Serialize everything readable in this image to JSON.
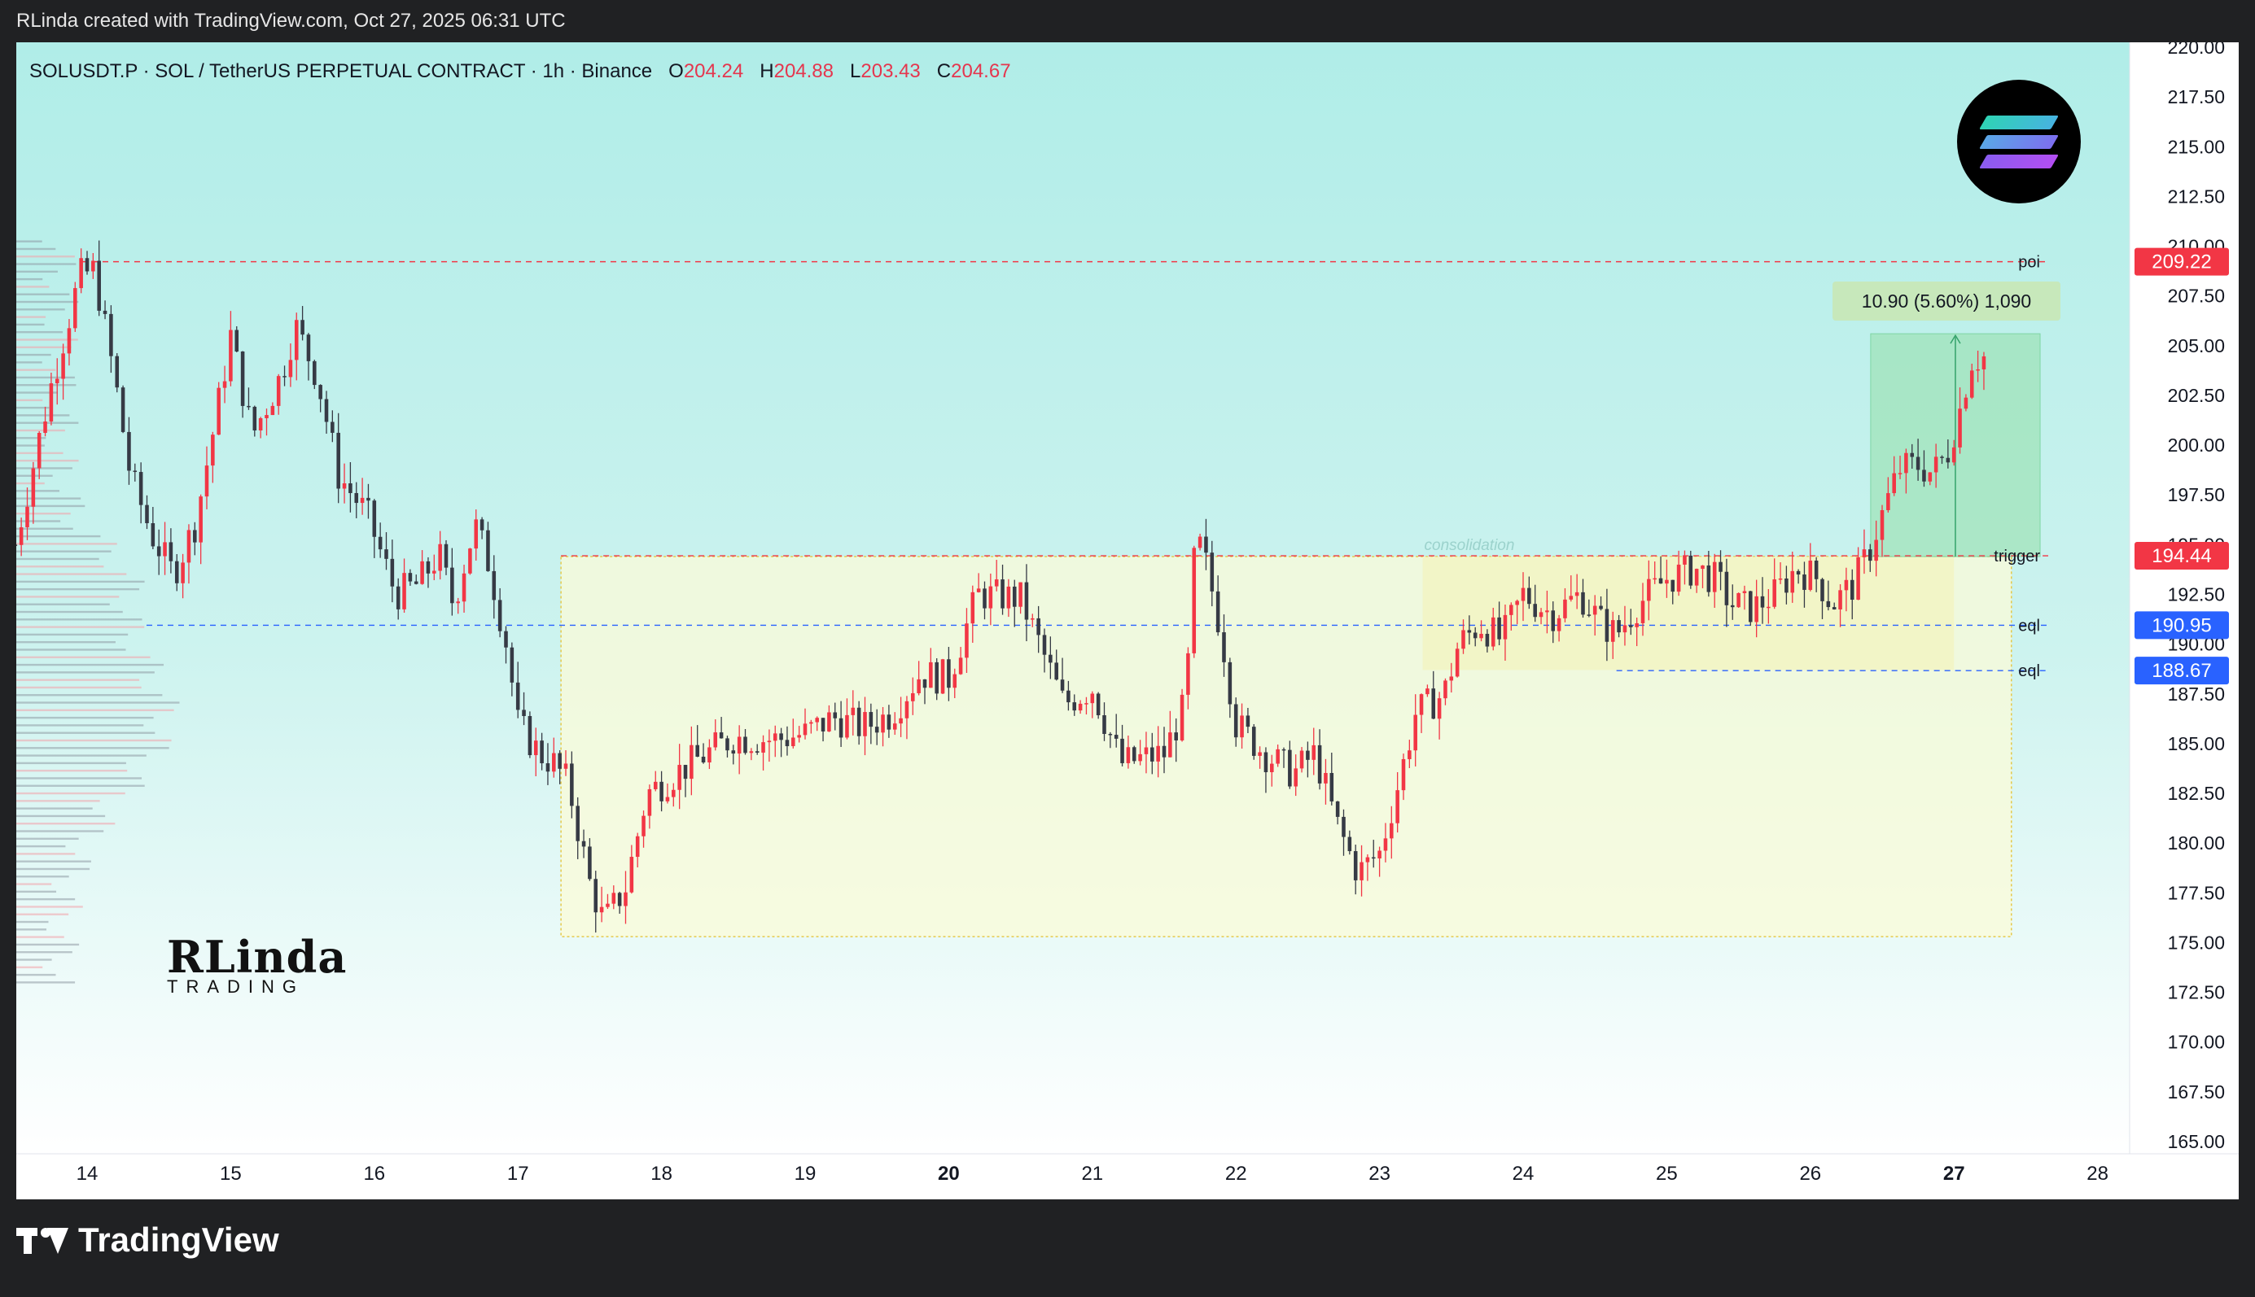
{
  "header": {
    "credit": "RLinda created with TradingView.com, Oct 27, 2025 06:31 UTC"
  },
  "legend": {
    "symbol": "SOLUSDT.P · SOL / TetherUS PERPETUAL CONTRACT · 1h · Binance",
    "o_label": "O",
    "o_value": "204.24",
    "h_label": "H",
    "h_value": "204.88",
    "l_label": "L",
    "l_value": "203.43",
    "c_label": "C",
    "c_value": "204.67"
  },
  "footer": {
    "brand": "TradingView"
  },
  "watermark": {
    "name": "RLinda",
    "sub": "TRADING"
  },
  "measure": {
    "label": "10.90 (5.60%) 1,090"
  },
  "colors": {
    "up": "#f23645",
    "down": "#363a45",
    "poi": "#f23645",
    "eql": "#2962ff",
    "box": "#f0d96a",
    "target": "#7fd6a4"
  },
  "chart_data": {
    "type": "candlestick",
    "interval": "1h",
    "ylim": [
      165,
      220
    ],
    "y_ticks": [
      "165.00",
      "167.50",
      "170.00",
      "172.50",
      "175.00",
      "177.50",
      "180.00",
      "182.50",
      "185.00",
      "187.50",
      "190.00",
      "192.50",
      "195.00",
      "197.50",
      "200.00",
      "202.50",
      "205.00",
      "207.50",
      "210.00",
      "212.50",
      "215.00",
      "217.50",
      "220.00"
    ],
    "x_ticks": [
      {
        "label": "14",
        "day": 14,
        "bold": false
      },
      {
        "label": "15",
        "day": 15,
        "bold": false
      },
      {
        "label": "16",
        "day": 16,
        "bold": false
      },
      {
        "label": "17",
        "day": 17,
        "bold": false
      },
      {
        "label": "18",
        "day": 18,
        "bold": false
      },
      {
        "label": "19",
        "day": 19,
        "bold": false
      },
      {
        "label": "20",
        "day": 20,
        "bold": true
      },
      {
        "label": "21",
        "day": 21,
        "bold": false
      },
      {
        "label": "22",
        "day": 22,
        "bold": false
      },
      {
        "label": "23",
        "day": 23,
        "bold": false
      },
      {
        "label": "24",
        "day": 24,
        "bold": false
      },
      {
        "label": "25",
        "day": 25,
        "bold": false
      },
      {
        "label": "26",
        "day": 26,
        "bold": false
      },
      {
        "label": "27",
        "day": 27,
        "bold": true
      },
      {
        "label": "28",
        "day": 28,
        "bold": false
      }
    ],
    "levels": [
      {
        "name": "poi",
        "price": 209.22,
        "label": "poi",
        "tag": "209.22",
        "color": "#f23645"
      },
      {
        "name": "trigger",
        "price": 194.44,
        "label": "trigger",
        "tag": "194.44",
        "color": "#f23645"
      },
      {
        "name": "eql-1",
        "price": 190.95,
        "label": "eql",
        "tag": "190.95",
        "color": "#2962ff"
      },
      {
        "name": "eql-2",
        "price": 188.67,
        "label": "eql",
        "tag": "188.67",
        "color": "#2962ff"
      }
    ],
    "zones": [
      {
        "name": "range-box",
        "x0": 17.3,
        "x1": 27.4,
        "y0": 175.3,
        "y1": 194.4
      },
      {
        "name": "consolidation-box",
        "x0": 23.3,
        "x1": 27.0,
        "y0": 188.7,
        "y1": 194.4,
        "label": "consolidation"
      },
      {
        "name": "target-box",
        "x0": 26.42,
        "x1": 27.6,
        "y0": 194.4,
        "y1": 205.6
      }
    ],
    "path": [
      [
        13.5,
        195.0
      ],
      [
        13.75,
        203.0
      ],
      [
        13.95,
        208.5
      ],
      [
        14.05,
        208.8
      ],
      [
        14.2,
        203.0
      ],
      [
        14.3,
        198.5
      ],
      [
        14.45,
        195.5
      ],
      [
        14.6,
        193.5
      ],
      [
        14.75,
        196.0
      ],
      [
        14.9,
        201.5
      ],
      [
        15.0,
        205.5
      ],
      [
        15.15,
        200.5
      ],
      [
        15.35,
        203.5
      ],
      [
        15.45,
        206.0
      ],
      [
        15.6,
        203.5
      ],
      [
        15.75,
        198.5
      ],
      [
        15.95,
        196.5
      ],
      [
        16.15,
        192.5
      ],
      [
        16.3,
        193.0
      ],
      [
        16.45,
        194.5
      ],
      [
        16.55,
        192.0
      ],
      [
        16.7,
        196.0
      ],
      [
        16.8,
        194.0
      ],
      [
        16.92,
        190.0
      ],
      [
        17.0,
        186.0
      ],
      [
        17.15,
        184.5
      ],
      [
        17.25,
        184.0
      ],
      [
        17.35,
        183.0
      ],
      [
        17.5,
        178.0
      ],
      [
        17.6,
        176.0
      ],
      [
        17.75,
        177.8
      ],
      [
        17.9,
        182.5
      ],
      [
        18.2,
        184.0
      ],
      [
        18.5,
        185.3
      ],
      [
        18.8,
        185.2
      ],
      [
        19.0,
        185.5
      ],
      [
        19.2,
        186.3
      ],
      [
        19.4,
        185.8
      ],
      [
        19.6,
        186.5
      ],
      [
        19.8,
        188.5
      ],
      [
        20.0,
        188.3
      ],
      [
        20.2,
        192.5
      ],
      [
        20.5,
        192.3
      ],
      [
        20.8,
        187.0
      ],
      [
        21.0,
        187.8
      ],
      [
        21.2,
        184.0
      ],
      [
        21.5,
        184.5
      ],
      [
        21.65,
        187.0
      ],
      [
        21.72,
        195.5
      ],
      [
        21.8,
        193.8
      ],
      [
        21.9,
        190.5
      ],
      [
        22.0,
        186.0
      ],
      [
        22.2,
        184.5
      ],
      [
        22.4,
        183.5
      ],
      [
        22.55,
        184.5
      ],
      [
        22.7,
        181.0
      ],
      [
        22.85,
        178.5
      ],
      [
        23.0,
        179.5
      ],
      [
        23.15,
        183.5
      ],
      [
        23.25,
        186.5
      ],
      [
        23.45,
        187.5
      ],
      [
        23.55,
        190.0
      ],
      [
        23.7,
        191.0
      ],
      [
        23.85,
        190.2
      ],
      [
        24.0,
        192.5
      ],
      [
        24.2,
        191.5
      ],
      [
        24.4,
        192.5
      ],
      [
        24.55,
        191.0
      ],
      [
        24.65,
        190.5
      ],
      [
        24.8,
        192.0
      ],
      [
        25.0,
        193.3
      ],
      [
        25.2,
        193.8
      ],
      [
        25.35,
        193.2
      ],
      [
        25.45,
        192.0
      ],
      [
        25.6,
        191.8
      ],
      [
        25.75,
        192.5
      ],
      [
        25.9,
        193.8
      ],
      [
        26.05,
        193.3
      ],
      [
        26.15,
        192.0
      ],
      [
        26.3,
        193.0
      ],
      [
        26.4,
        194.5
      ],
      [
        26.5,
        196.5
      ],
      [
        26.62,
        198.8
      ],
      [
        26.75,
        199.0
      ],
      [
        26.85,
        198.6
      ],
      [
        26.95,
        199.5
      ],
      [
        27.05,
        202.0
      ],
      [
        27.12,
        204.3
      ],
      [
        27.25,
        204.5
      ]
    ],
    "volume_profile": "horizontal volume-by-price histogram on left edge (bars drawn as marks)"
  }
}
